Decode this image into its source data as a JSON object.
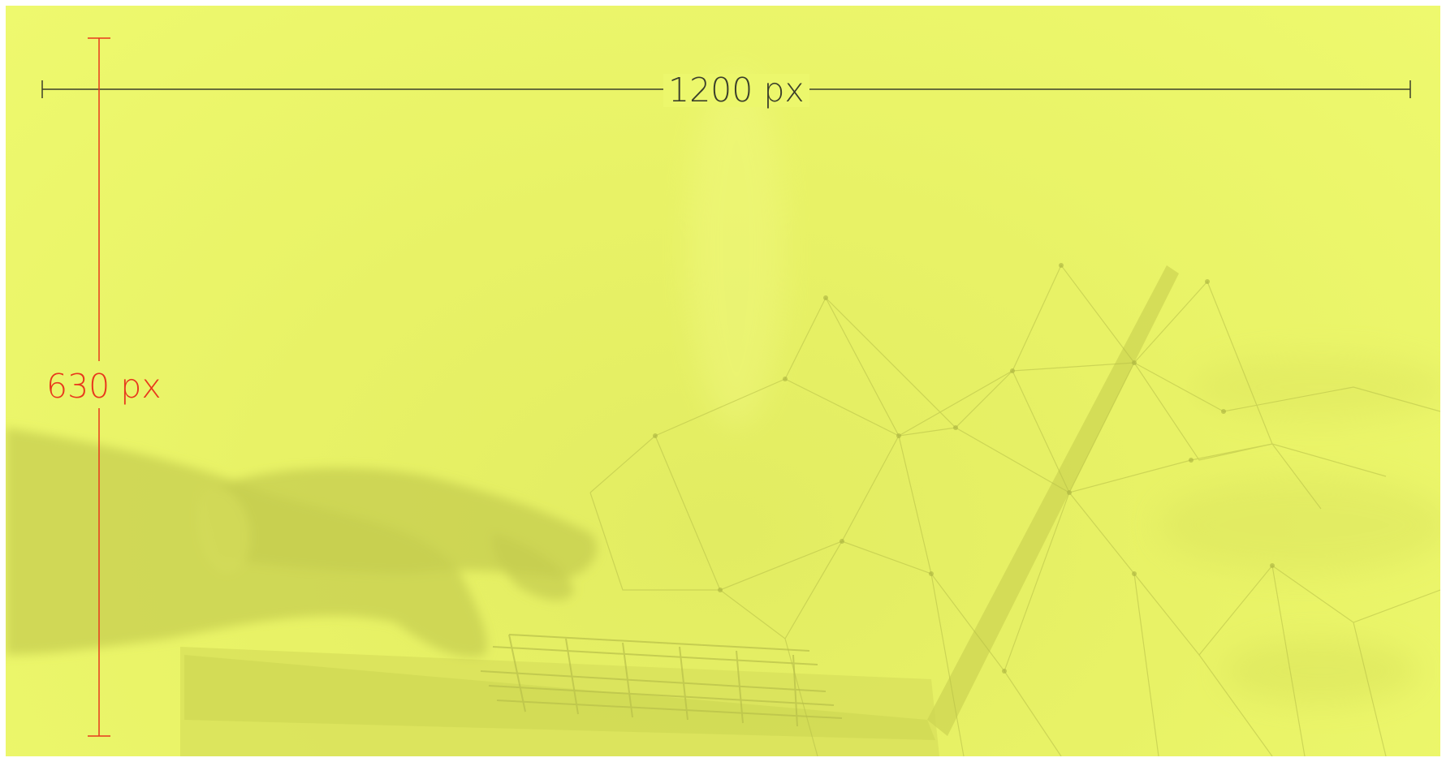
{
  "dimensions": {
    "width_label": "1200 px",
    "height_label": "630 px"
  },
  "colors": {
    "background": "#eef96e",
    "width_indicator": "#3b3f2a",
    "height_indicator": "#e8381c"
  },
  "background_image": "hands-typing-on-laptop-with-network-lines"
}
